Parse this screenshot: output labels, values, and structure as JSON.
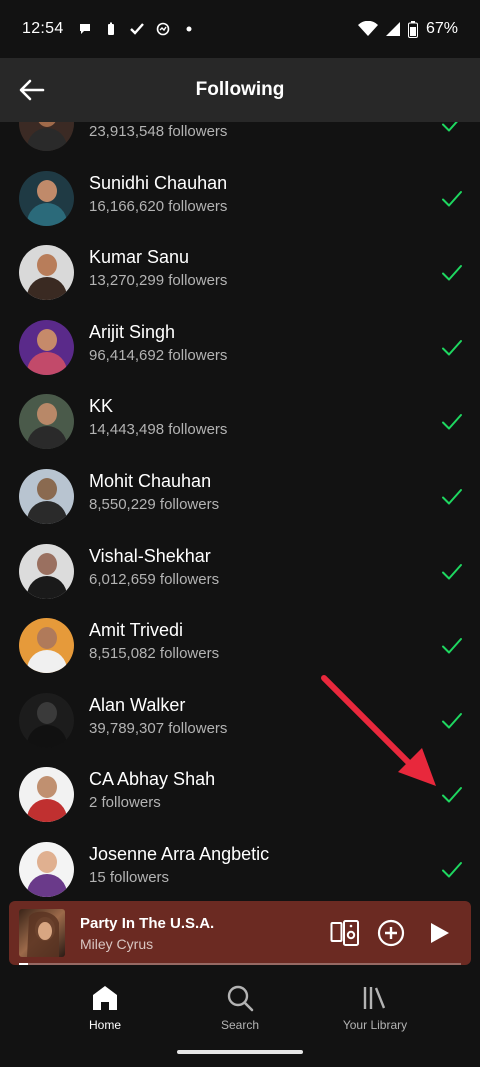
{
  "status_bar": {
    "time": "12:54",
    "battery": "67%"
  },
  "header": {
    "title": "Following"
  },
  "artists": [
    {
      "name": "",
      "followers": "23,913,548 followers",
      "following": true,
      "avatar_bg": "#3b2a24",
      "skin": "#a06a4a",
      "shirt": "#2a2a2a"
    },
    {
      "name": "Sunidhi Chauhan",
      "followers": "16,166,620 followers",
      "following": true,
      "avatar_bg": "#1f3a44",
      "skin": "#c08a6a",
      "shirt": "#2b6a7a"
    },
    {
      "name": "Kumar Sanu",
      "followers": "13,270,299 followers",
      "following": true,
      "avatar_bg": "#d9d9d9",
      "skin": "#b87d5a",
      "shirt": "#3a2a22"
    },
    {
      "name": "Arijit Singh",
      "followers": "96,414,692 followers",
      "following": true,
      "avatar_bg": "#5a2a8a",
      "skin": "#c68a6a",
      "shirt": "#c24a6a"
    },
    {
      "name": "KK",
      "followers": "14,443,498 followers",
      "following": true,
      "avatar_bg": "#4a5a4a",
      "skin": "#b88868",
      "shirt": "#2a2a2a"
    },
    {
      "name": "Mohit Chauhan",
      "followers": "8,550,229 followers",
      "following": true,
      "avatar_bg": "#b8c4d0",
      "skin": "#8a6a50",
      "shirt": "#2a2a2a"
    },
    {
      "name": "Vishal-Shekhar",
      "followers": "6,012,659 followers",
      "following": true,
      "avatar_bg": "#dcdcdc",
      "skin": "#9a7060",
      "shirt": "#1a1a1a"
    },
    {
      "name": "Amit Trivedi",
      "followers": "8,515,082 followers",
      "following": true,
      "avatar_bg": "#e69a3a",
      "skin": "#b07a5a",
      "shirt": "#f0f0f0"
    },
    {
      "name": "Alan Walker",
      "followers": "39,789,307 followers",
      "following": true,
      "avatar_bg": "#1c1c1c",
      "skin": "#3a3a3a",
      "shirt": "#111111"
    },
    {
      "name": "CA Abhay Shah",
      "followers": "2 followers",
      "following": true,
      "avatar_bg": "#f2f2f2",
      "skin": "#c09070",
      "shirt": "#c03030"
    },
    {
      "name": "Josenne Arra Angbetic",
      "followers": "15 followers",
      "following": true,
      "avatar_bg": "#f4f4f4",
      "skin": "#e0b090",
      "shirt": "#6a3a8a"
    }
  ],
  "now_playing": {
    "title": "Party In The U.S.A.",
    "artist": "Miley Cyrus",
    "progress": 0.02
  },
  "nav": {
    "home": "Home",
    "search": "Search",
    "library": "Your Library"
  },
  "colors": {
    "accent_green": "#1ed760",
    "miniplayer_bg": "#6b2a22",
    "arrow": "#e8283c"
  }
}
